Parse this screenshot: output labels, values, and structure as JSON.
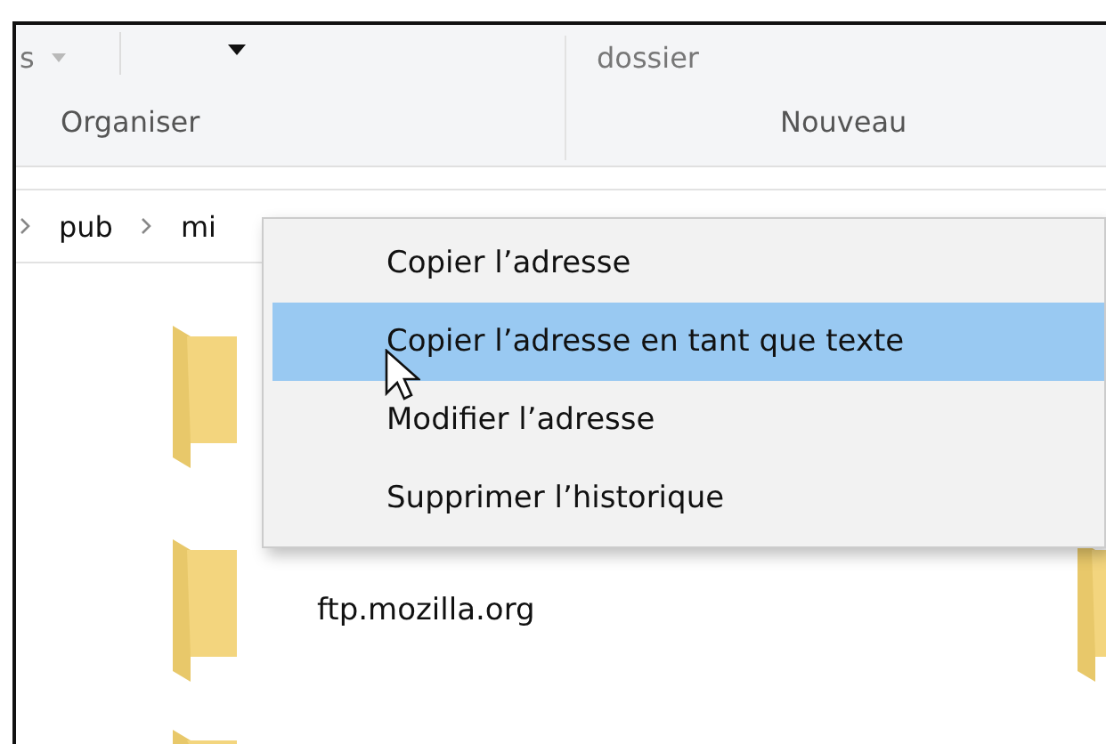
{
  "ribbon": {
    "groups": [
      {
        "command": "s",
        "label": "Organiser"
      },
      {
        "command": "dossier",
        "label": "Nouveau"
      }
    ]
  },
  "address_bar": {
    "segments": [
      "pub",
      "mi"
    ]
  },
  "files": [
    {
      "name": "ftp.mozilla.org"
    }
  ],
  "context_menu": {
    "items": [
      {
        "label": "Copier l’adresse",
        "selected": false
      },
      {
        "label": "Copier l’adresse en tant que texte",
        "selected": true
      },
      {
        "label": "Modifier l’adresse",
        "selected": false
      },
      {
        "label": "Supprimer l’historique",
        "selected": false
      }
    ]
  }
}
